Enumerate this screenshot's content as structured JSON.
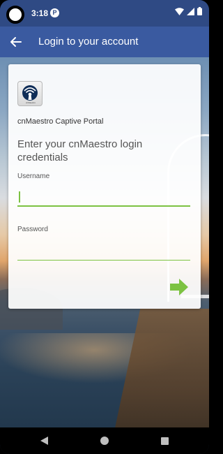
{
  "status_bar": {
    "time": "3:18",
    "notification_letter": "P",
    "icons": [
      "wifi-icon",
      "signal-icon",
      "battery-icon"
    ]
  },
  "app_bar": {
    "title": "Login to your account",
    "back_icon": "back-arrow-icon"
  },
  "card": {
    "logo_caption": "cnMaestro",
    "portal_name": "cnMaestro Captive Portal",
    "heading": "Enter your cnMaestro login credentials",
    "username": {
      "label": "Username",
      "value": "",
      "placeholder": ""
    },
    "password": {
      "label": "Password",
      "value": "",
      "placeholder": ""
    },
    "submit_icon": "arrow-right-icon"
  },
  "colors": {
    "status_bar": "#2f4a84",
    "app_bar": "#3a5aa0",
    "accent": "#7cc242"
  },
  "nav_bar": {
    "icons": [
      "nav-back-icon",
      "nav-home-icon",
      "nav-recent-icon"
    ]
  }
}
